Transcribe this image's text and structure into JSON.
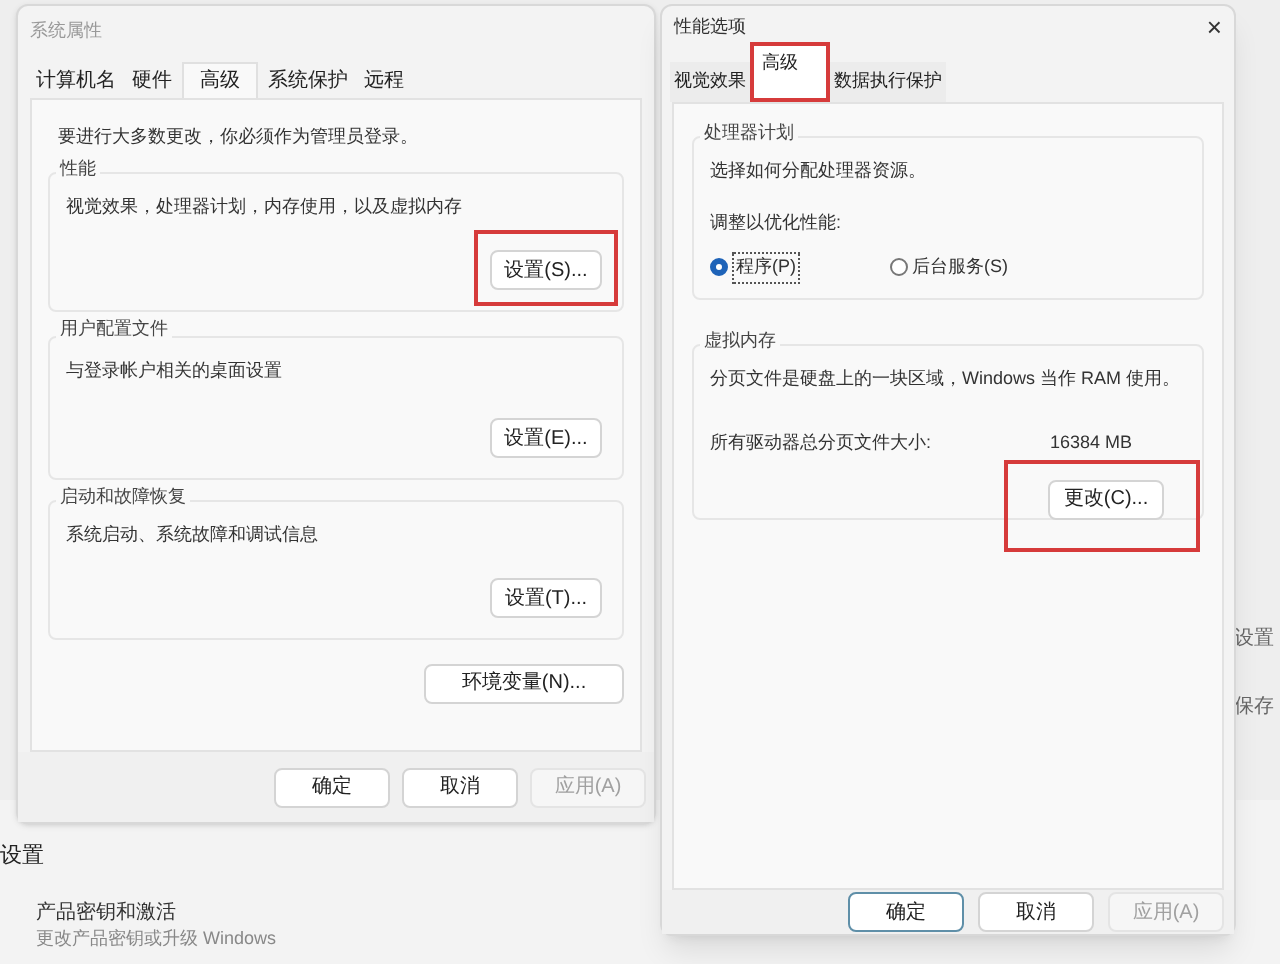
{
  "background": {
    "left_heading": "设置",
    "item_title": "产品密钥和激活",
    "item_subtitle": "更改产品密钥或升级 Windows",
    "right_items": [
      "设置",
      "保存"
    ]
  },
  "system_properties": {
    "title": "系统属性",
    "tabs": [
      {
        "label": "计算机名",
        "selected": false
      },
      {
        "label": "硬件",
        "selected": false
      },
      {
        "label": "高级",
        "selected": true
      },
      {
        "label": "系统保护",
        "selected": false
      },
      {
        "label": "远程",
        "selected": false
      }
    ],
    "notice": "要进行大多数更改，你必须作为管理员登录。",
    "groups": [
      {
        "title": "性能",
        "description": "视觉效果，处理器计划，内存使用，以及虚拟内存",
        "button": "设置(S)...",
        "highlighted": true
      },
      {
        "title": "用户配置文件",
        "description": "与登录帐户相关的桌面设置",
        "button": "设置(E)...",
        "highlighted": false
      },
      {
        "title": "启动和故障恢复",
        "description": "系统启动、系统故障和调试信息",
        "button": "设置(T)...",
        "highlighted": false
      }
    ],
    "env_button": "环境变量(N)...",
    "buttons": [
      {
        "label": "确定",
        "disabled": false
      },
      {
        "label": "取消",
        "disabled": false
      },
      {
        "label": "应用(A)",
        "disabled": true
      }
    ]
  },
  "performance_options": {
    "title": "性能选项",
    "close": "×",
    "tabs": [
      {
        "label": "视觉效果",
        "selected": false,
        "highlighted": false
      },
      {
        "label": "高级",
        "selected": true,
        "highlighted": true
      },
      {
        "label": "数据执行保护",
        "selected": false,
        "highlighted": false
      }
    ],
    "processor": {
      "title": "处理器计划",
      "description": "选择如何分配处理器资源。",
      "prompt": "调整以优化性能:",
      "options": [
        {
          "label": "程序(P)",
          "selected": true
        },
        {
          "label": "后台服务(S)",
          "selected": false
        }
      ]
    },
    "virtual_memory": {
      "title": "虚拟内存",
      "description": "分页文件是硬盘上的一块区域，Windows 当作 RAM 使用。",
      "size_label": "所有驱动器总分页文件大小:",
      "size_value": "16384 MB",
      "button": "更改(C)...",
      "highlighted": true
    },
    "buttons": [
      {
        "label": "确定",
        "disabled": false
      },
      {
        "label": "取消",
        "disabled": false
      },
      {
        "label": "应用(A)",
        "disabled": true
      }
    ]
  }
}
